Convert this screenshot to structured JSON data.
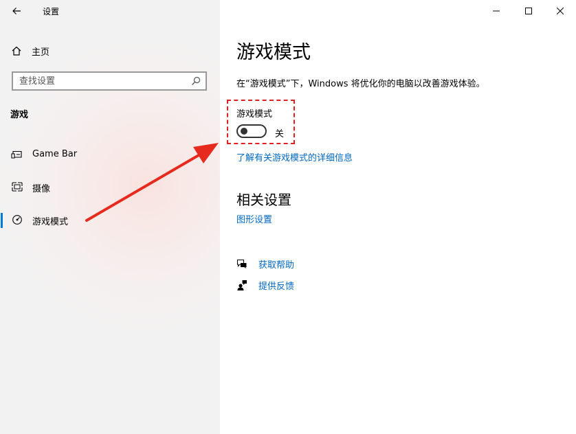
{
  "window": {
    "title": "设置",
    "controls": [
      "minimize",
      "maximize",
      "close"
    ]
  },
  "sidebar": {
    "home_label": "主页",
    "search_placeholder": "查找设置",
    "section_title": "游戏",
    "items": [
      {
        "label": "Game Bar",
        "icon": "game-bar-icon",
        "selected": false
      },
      {
        "label": "摄像",
        "icon": "capture-icon",
        "selected": false
      },
      {
        "label": "游戏模式",
        "icon": "game-mode-icon",
        "selected": true
      }
    ]
  },
  "main": {
    "page_title": "游戏模式",
    "description": "在“游戏模式”下，Windows 将优化你的电脑以改善游戏体验。",
    "toggle": {
      "label": "游戏模式",
      "state_text": "关",
      "on": false
    },
    "learn_more": "了解有关游戏模式的详细信息",
    "related_title": "相关设置",
    "related_link": "图形设置",
    "help": [
      {
        "label": "获取帮助",
        "icon": "help-icon"
      },
      {
        "label": "提供反馈",
        "icon": "feedback-icon"
      }
    ]
  },
  "colors": {
    "accent": "#0078d7",
    "link": "#0067c0",
    "annotation": "#e02020",
    "sidebar_bg": "#f2f2f2"
  }
}
